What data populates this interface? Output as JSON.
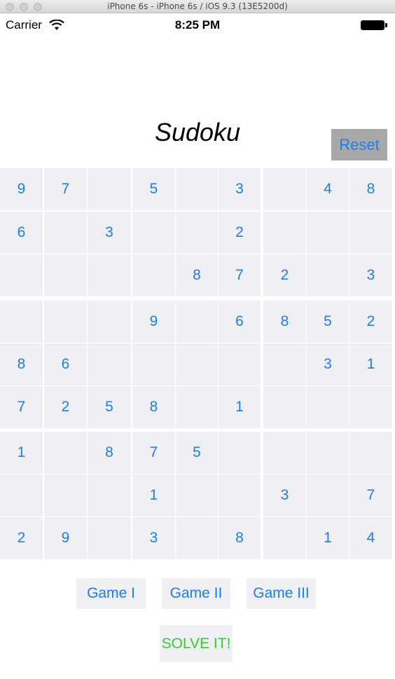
{
  "window": {
    "title": "iPhone 6s - iPhone 6s / iOS 9.3 (13E5200d)"
  },
  "statusbar": {
    "carrier": "Carrier",
    "time": "8:25 PM"
  },
  "app": {
    "title": "Sudoku",
    "reset_label": "Reset"
  },
  "grid": [
    [
      "9",
      "7",
      "",
      "5",
      "",
      "3",
      "",
      "4",
      "8"
    ],
    [
      "6",
      "",
      "3",
      "",
      "",
      "2",
      "",
      "",
      ""
    ],
    [
      "",
      "",
      "",
      "",
      "8",
      "7",
      "2",
      "",
      "3"
    ],
    [
      "",
      "",
      "",
      "9",
      "",
      "6",
      "8",
      "5",
      "2"
    ],
    [
      "8",
      "6",
      "",
      "",
      "",
      "",
      "",
      "3",
      "1"
    ],
    [
      "7",
      "2",
      "5",
      "8",
      "",
      "1",
      "",
      "",
      ""
    ],
    [
      "1",
      "",
      "8",
      "7",
      "5",
      "",
      "",
      "",
      ""
    ],
    [
      "",
      "",
      "",
      "1",
      "",
      "",
      "3",
      "",
      "7"
    ],
    [
      "2",
      "9",
      "",
      "3",
      "",
      "8",
      "",
      "1",
      "4"
    ]
  ],
  "games": [
    "Game I",
    "Game II",
    "Game III"
  ],
  "solve_label": "SOLVE IT!",
  "colors": {
    "accent": "#1b7ef0",
    "solve": "#2fd12f",
    "cell_bg": "#efeff4",
    "reset_bg": "#a8a8a8"
  }
}
